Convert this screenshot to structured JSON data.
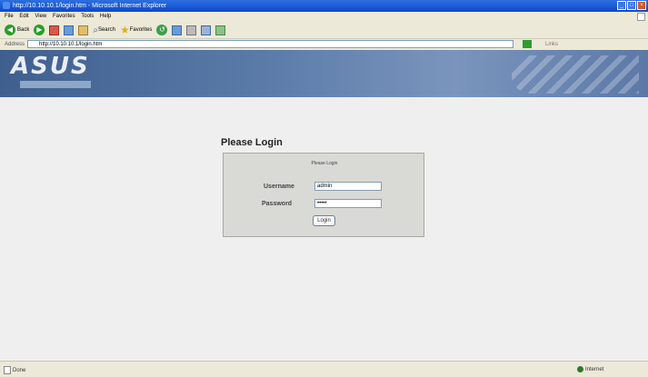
{
  "window": {
    "title": "http://10.10.10.1/login.htm - Microsoft Internet Explorer",
    "controls": [
      "_",
      "□",
      "×"
    ]
  },
  "menu": [
    "File",
    "Edit",
    "View",
    "Favorites",
    "Tools",
    "Help"
  ],
  "toolbar": {
    "back_label": "Back",
    "search_label": "Search",
    "favorites_label": "Favorites"
  },
  "address": {
    "label": "Address",
    "url": "http://10.10.10.1/login.htm",
    "go_label": "Go",
    "links_label": "Links"
  },
  "brand": {
    "logo_text": "ASUS"
  },
  "login": {
    "heading": "Please Login",
    "panel_title": "Please Login",
    "username_label": "Username",
    "username_value": "admin",
    "password_label": "Password",
    "password_value": "•••••",
    "button_label": "Login"
  },
  "status": {
    "left": "Done",
    "zone": "Internet"
  },
  "colors": {
    "titlebar": "#0c49c8",
    "header": "#5a7aa8",
    "content_bg": "#efefef",
    "panel_bg": "#d9d9d6"
  }
}
